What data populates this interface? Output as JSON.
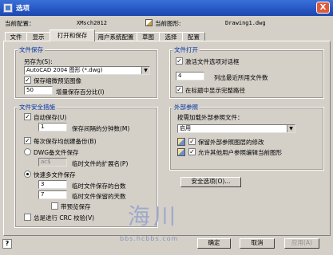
{
  "window": {
    "title": "选项",
    "close_glyph": "X"
  },
  "config": {
    "current_profile_label": "当前配置：",
    "current_profile_value": "XMsch2012",
    "current_drawing_label": "当前图形:",
    "current_drawing_value": "Drawing1.dwg"
  },
  "tabs": [
    "文件",
    "显示",
    "打开和保存",
    "用户系统配置",
    "草图",
    "选择",
    "配置"
  ],
  "file_save": {
    "legend": "文件保存",
    "save_as_label": "另存为(S):",
    "save_as_value": "AutoCAD 2004 图形 (*.dwg)",
    "thumbnail_label": "保存缩微预览图像",
    "increment_value": "50",
    "increment_label": "增量保存百分比(I)"
  },
  "file_safety": {
    "legend": "文件安全措施",
    "autosave_label": "自动保存(U)",
    "minutes_value": "1",
    "minutes_label": "保存间隔的分钟数(M)",
    "backup_label": "每次保存均创建备份(B)",
    "dwg_backup_label": "DWG备文件保存",
    "temp_ext_value": "ac$",
    "temp_ext_label": "临时文件的扩展名(P)",
    "fast_backup_label": "快速多文件保存",
    "count_value": "3",
    "count_label": "临时文件保存的台数",
    "days_value": "7",
    "days_label": "临时文件保留的天数",
    "keep_backup_label": "带预览保存",
    "crc_label": "总是进行 CRC 校验(V)"
  },
  "file_open": {
    "legend": "文件打开",
    "sort_label": "激活文件选项对话框",
    "recent_value": "4",
    "recent_label": "列出最近所用文件数",
    "fullpath_label": "在标题中显示完整路径"
  },
  "xref": {
    "legend": "外部参照",
    "demand_load_label": "按需加载外部参照文件：",
    "demand_load_value": "启用",
    "retain_changes_label": "保留外部参照图层的修改",
    "allow_edit_label": "允许其他用户参照编辑当前图形"
  },
  "buttons": {
    "security": "安全选项(O)...",
    "ok": "确定",
    "cancel": "取消",
    "apply": "应用(A)",
    "help_glyph": "?"
  },
  "watermark": {
    "text": "海川",
    "url": "bbs.hcbbs.com"
  },
  "colors": {
    "title_bar": "#2656c2",
    "legend_text": "#0033aa",
    "dialog_bg": "#d4d0c8"
  }
}
